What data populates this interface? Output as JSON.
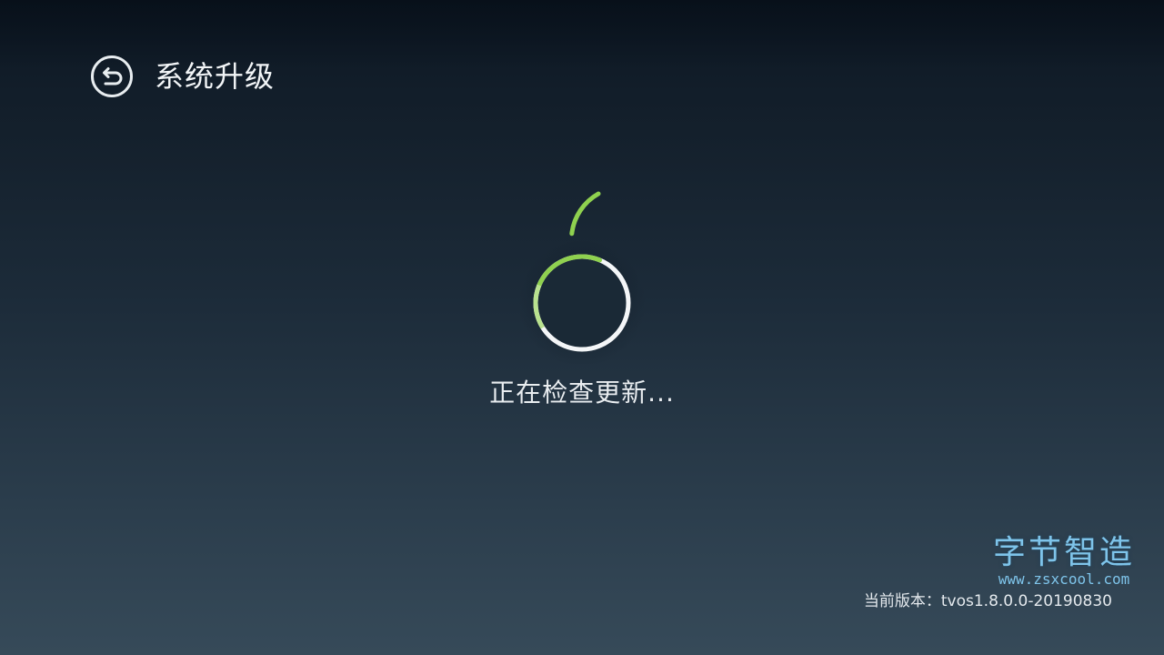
{
  "header": {
    "back_icon": "back-arrow-icon",
    "title": "系统升级"
  },
  "update_check": {
    "status_text": "正在检查更新...",
    "spinner_icon": "loading-spinner-icon",
    "progress_fraction": 0.25,
    "accent_color": "#8fd14f",
    "ring_color": "#ffffff"
  },
  "watermark": {
    "name": "字节智造",
    "url": "www.zsxcool.com"
  },
  "footer": {
    "version_label": "当前版本：",
    "version_value": "tvos1.8.0.0-20190830"
  }
}
